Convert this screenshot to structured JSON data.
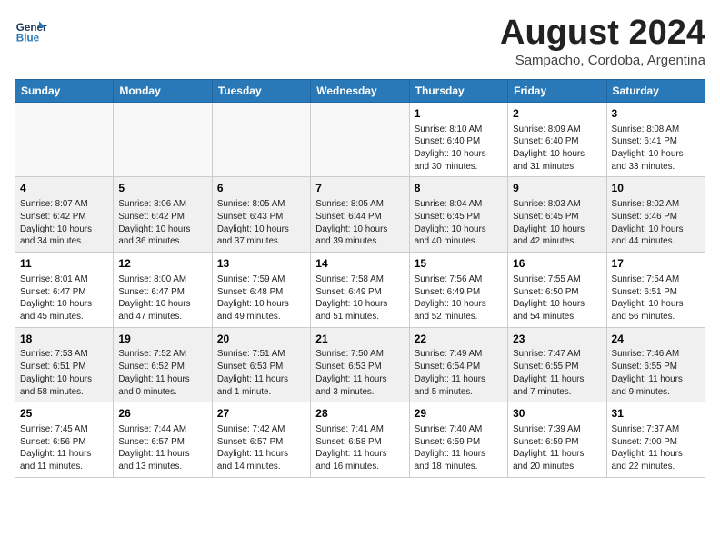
{
  "header": {
    "logo_line1": "General",
    "logo_line2": "Blue",
    "month": "August 2024",
    "location": "Sampacho, Cordoba, Argentina"
  },
  "days_of_week": [
    "Sunday",
    "Monday",
    "Tuesday",
    "Wednesday",
    "Thursday",
    "Friday",
    "Saturday"
  ],
  "weeks": [
    [
      {
        "day": "",
        "info": "",
        "empty": true
      },
      {
        "day": "",
        "info": "",
        "empty": true
      },
      {
        "day": "",
        "info": "",
        "empty": true
      },
      {
        "day": "",
        "info": "",
        "empty": true
      },
      {
        "day": "1",
        "info": "Sunrise: 8:10 AM\nSunset: 6:40 PM\nDaylight: 10 hours\nand 30 minutes."
      },
      {
        "day": "2",
        "info": "Sunrise: 8:09 AM\nSunset: 6:40 PM\nDaylight: 10 hours\nand 31 minutes."
      },
      {
        "day": "3",
        "info": "Sunrise: 8:08 AM\nSunset: 6:41 PM\nDaylight: 10 hours\nand 33 minutes."
      }
    ],
    [
      {
        "day": "4",
        "info": "Sunrise: 8:07 AM\nSunset: 6:42 PM\nDaylight: 10 hours\nand 34 minutes."
      },
      {
        "day": "5",
        "info": "Sunrise: 8:06 AM\nSunset: 6:42 PM\nDaylight: 10 hours\nand 36 minutes."
      },
      {
        "day": "6",
        "info": "Sunrise: 8:05 AM\nSunset: 6:43 PM\nDaylight: 10 hours\nand 37 minutes."
      },
      {
        "day": "7",
        "info": "Sunrise: 8:05 AM\nSunset: 6:44 PM\nDaylight: 10 hours\nand 39 minutes."
      },
      {
        "day": "8",
        "info": "Sunrise: 8:04 AM\nSunset: 6:45 PM\nDaylight: 10 hours\nand 40 minutes."
      },
      {
        "day": "9",
        "info": "Sunrise: 8:03 AM\nSunset: 6:45 PM\nDaylight: 10 hours\nand 42 minutes."
      },
      {
        "day": "10",
        "info": "Sunrise: 8:02 AM\nSunset: 6:46 PM\nDaylight: 10 hours\nand 44 minutes."
      }
    ],
    [
      {
        "day": "11",
        "info": "Sunrise: 8:01 AM\nSunset: 6:47 PM\nDaylight: 10 hours\nand 45 minutes."
      },
      {
        "day": "12",
        "info": "Sunrise: 8:00 AM\nSunset: 6:47 PM\nDaylight: 10 hours\nand 47 minutes."
      },
      {
        "day": "13",
        "info": "Sunrise: 7:59 AM\nSunset: 6:48 PM\nDaylight: 10 hours\nand 49 minutes."
      },
      {
        "day": "14",
        "info": "Sunrise: 7:58 AM\nSunset: 6:49 PM\nDaylight: 10 hours\nand 51 minutes."
      },
      {
        "day": "15",
        "info": "Sunrise: 7:56 AM\nSunset: 6:49 PM\nDaylight: 10 hours\nand 52 minutes."
      },
      {
        "day": "16",
        "info": "Sunrise: 7:55 AM\nSunset: 6:50 PM\nDaylight: 10 hours\nand 54 minutes."
      },
      {
        "day": "17",
        "info": "Sunrise: 7:54 AM\nSunset: 6:51 PM\nDaylight: 10 hours\nand 56 minutes."
      }
    ],
    [
      {
        "day": "18",
        "info": "Sunrise: 7:53 AM\nSunset: 6:51 PM\nDaylight: 10 hours\nand 58 minutes."
      },
      {
        "day": "19",
        "info": "Sunrise: 7:52 AM\nSunset: 6:52 PM\nDaylight: 11 hours\nand 0 minutes."
      },
      {
        "day": "20",
        "info": "Sunrise: 7:51 AM\nSunset: 6:53 PM\nDaylight: 11 hours\nand 1 minute."
      },
      {
        "day": "21",
        "info": "Sunrise: 7:50 AM\nSunset: 6:53 PM\nDaylight: 11 hours\nand 3 minutes."
      },
      {
        "day": "22",
        "info": "Sunrise: 7:49 AM\nSunset: 6:54 PM\nDaylight: 11 hours\nand 5 minutes."
      },
      {
        "day": "23",
        "info": "Sunrise: 7:47 AM\nSunset: 6:55 PM\nDaylight: 11 hours\nand 7 minutes."
      },
      {
        "day": "24",
        "info": "Sunrise: 7:46 AM\nSunset: 6:55 PM\nDaylight: 11 hours\nand 9 minutes."
      }
    ],
    [
      {
        "day": "25",
        "info": "Sunrise: 7:45 AM\nSunset: 6:56 PM\nDaylight: 11 hours\nand 11 minutes."
      },
      {
        "day": "26",
        "info": "Sunrise: 7:44 AM\nSunset: 6:57 PM\nDaylight: 11 hours\nand 13 minutes."
      },
      {
        "day": "27",
        "info": "Sunrise: 7:42 AM\nSunset: 6:57 PM\nDaylight: 11 hours\nand 14 minutes."
      },
      {
        "day": "28",
        "info": "Sunrise: 7:41 AM\nSunset: 6:58 PM\nDaylight: 11 hours\nand 16 minutes."
      },
      {
        "day": "29",
        "info": "Sunrise: 7:40 AM\nSunset: 6:59 PM\nDaylight: 11 hours\nand 18 minutes."
      },
      {
        "day": "30",
        "info": "Sunrise: 7:39 AM\nSunset: 6:59 PM\nDaylight: 11 hours\nand 20 minutes."
      },
      {
        "day": "31",
        "info": "Sunrise: 7:37 AM\nSunset: 7:00 PM\nDaylight: 11 hours\nand 22 minutes."
      }
    ]
  ]
}
